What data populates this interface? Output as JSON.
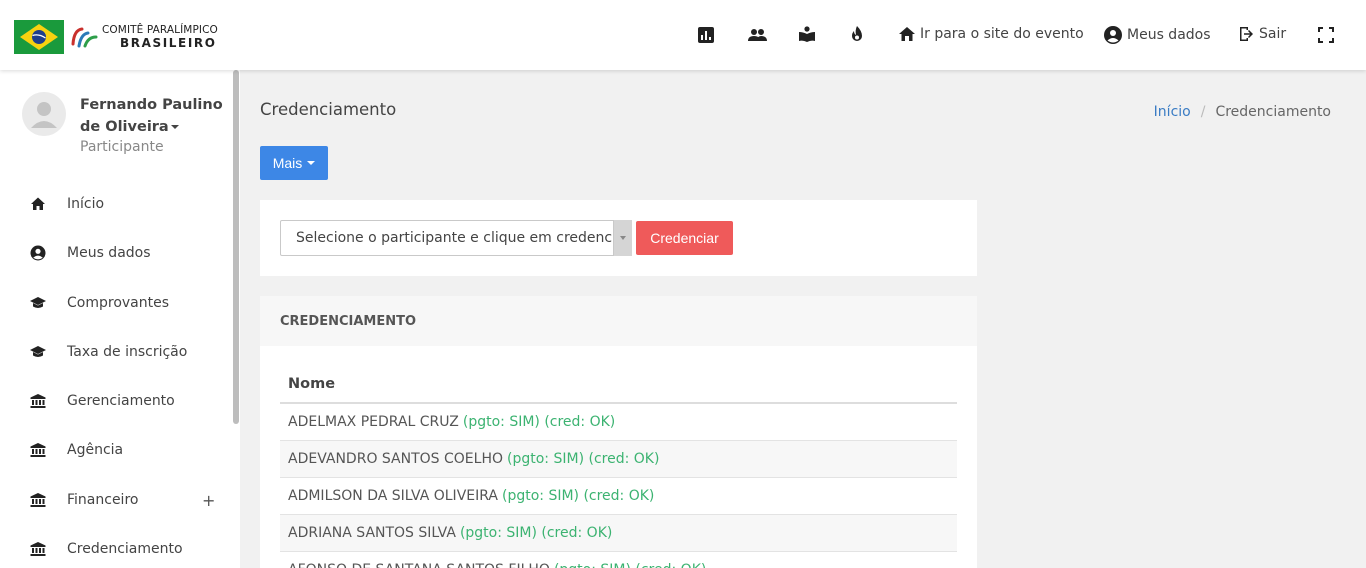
{
  "brand": {
    "line1": "COMITÊ PARALÍMPICO",
    "line2": "BRASILEIRO",
    "flag_green": "#1a9a3c",
    "flag_yellow": "#f7d210",
    "flag_blue": "#1e3e8c"
  },
  "topnav": {
    "icons": [
      "chart-icon",
      "people-icon",
      "reader-icon",
      "flame-icon"
    ],
    "site_label": "Ir para o site do evento",
    "profile_label": "Meus dados",
    "logout_label": "Sair"
  },
  "user": {
    "name_line1": "Fernando Paulino",
    "name_line2": "de Oliveira",
    "role": "Participante"
  },
  "sidebar": {
    "items": [
      {
        "label": "Início",
        "icon": "home-icon"
      },
      {
        "label": "Meus dados",
        "icon": "user-circle-icon"
      },
      {
        "label": "Comprovantes",
        "icon": "graduation-cap-icon"
      },
      {
        "label": "Taxa de inscrição",
        "icon": "graduation-cap-icon"
      },
      {
        "label": "Gerenciamento",
        "icon": "bank-icon"
      },
      {
        "label": "Agência",
        "icon": "bank-icon"
      },
      {
        "label": "Financeiro",
        "icon": "bank-icon",
        "expand": "+"
      },
      {
        "label": "Credenciamento",
        "icon": "bank-icon"
      }
    ]
  },
  "page": {
    "title": "Credenciamento",
    "breadcrumb": {
      "home": "Início",
      "current": "Credenciamento"
    },
    "more_button": "Mais",
    "select_placeholder": "Selecione o participante e clique em credenciar",
    "credenciar_button": "Credenciar"
  },
  "panel": {
    "heading": "CREDENCIAMENTO",
    "column": "Nome",
    "rows": [
      {
        "name": "ADELMAX PEDRAL CRUZ",
        "status": "(pgto: SIM) (cred: OK)"
      },
      {
        "name": "ADEVANDRO SANTOS COELHO",
        "status": "(pgto: SIM) (cred: OK)"
      },
      {
        "name": "ADMILSON DA SILVA OLIVEIRA",
        "status": "(pgto: SIM) (cred: OK)"
      },
      {
        "name": "ADRIANA SANTOS SILVA",
        "status": "(pgto: SIM) (cred: OK)"
      },
      {
        "name": "AFONSO DE SANTANA SANTOS FILHO",
        "status": "(pgto: SIM) (cred: OK)"
      }
    ]
  },
  "colors": {
    "primary": "#3d87e6",
    "danger": "#ef5a5a",
    "success": "#3cb371",
    "link": "#3a7cc4"
  }
}
